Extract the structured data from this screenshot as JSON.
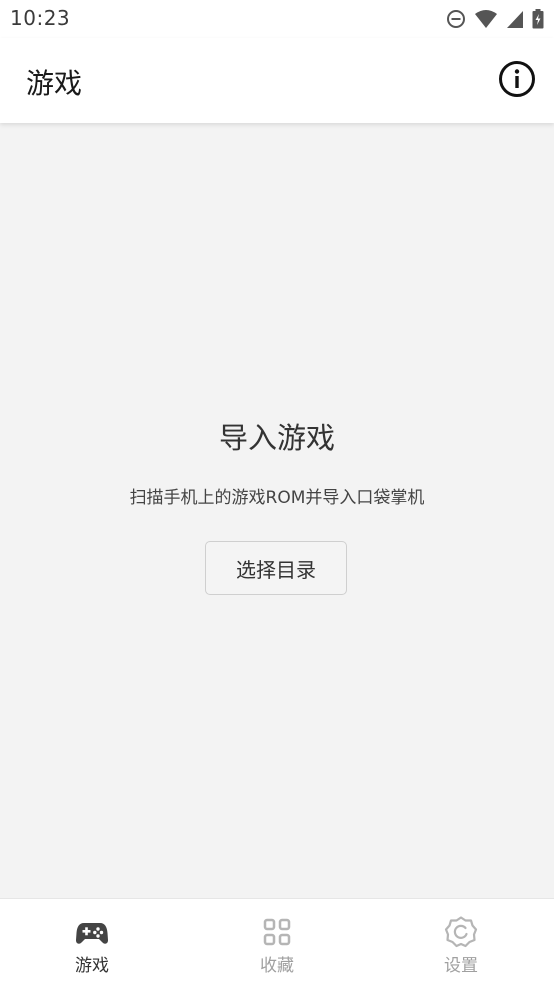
{
  "status_bar": {
    "time": "10:23",
    "icons": [
      "do-not-disturb-icon",
      "wifi-icon",
      "cell-signal-icon",
      "battery-charging-icon"
    ]
  },
  "app_bar": {
    "title": "游戏",
    "info_icon": "info-icon"
  },
  "main": {
    "empty_title": "导入游戏",
    "empty_description": "扫描手机上的游戏ROM并导入口袋掌机",
    "choose_directory_label": "选择目录"
  },
  "bottom_nav": {
    "items": [
      {
        "label": "游戏",
        "icon": "gamepad-icon",
        "active": true
      },
      {
        "label": "收藏",
        "icon": "grid-icon",
        "active": false
      },
      {
        "label": "设置",
        "icon": "settings-icon",
        "active": false
      }
    ],
    "active_color": "#333333",
    "inactive_color": "#a0a0a0"
  }
}
